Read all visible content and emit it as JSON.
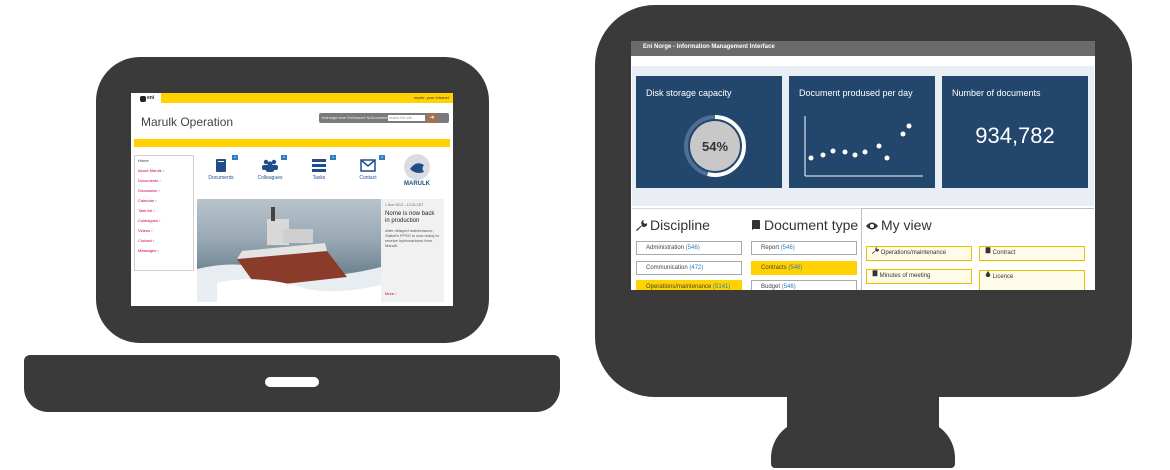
{
  "laptop": {
    "header": {
      "logo_text": "eni",
      "login_text": "mystir: your intranet",
      "title": "Marulk Operation",
      "search_links": "eninorge.com  Enhanced  NoDocument",
      "search_placeholder": "search the site...",
      "search_button": "➔"
    },
    "sidebar": {
      "items": [
        {
          "label": "Home"
        },
        {
          "label": "About Marulk ›"
        },
        {
          "label": "Documents ›"
        },
        {
          "label": "Discussion ›"
        },
        {
          "label": "Calendar ›"
        },
        {
          "label": "Task list ›"
        },
        {
          "label": "Colleagues ›"
        },
        {
          "label": "Videos ›"
        },
        {
          "label": "Contact ›"
        },
        {
          "label": "Messages ›"
        }
      ]
    },
    "tiles": [
      {
        "label": "Documents",
        "badge": "4"
      },
      {
        "label": "Colleagues",
        "badge": "3"
      },
      {
        "label": "Tasks",
        "badge": "4"
      },
      {
        "label": "Contact",
        "badge": "4"
      }
    ],
    "marulk_label": "MARULK",
    "news": {
      "date": "1 Nov 2013 – 12:34 CET",
      "headline": "Norne is now back in production",
      "body": "After delayed maintenance, Statoil's FPSO is now ready to receive hydrocarbons from Marulk.",
      "more": "More ›"
    }
  },
  "monitor": {
    "window_title": "Eni Norge - Information Management Interface",
    "cards": {
      "disk": {
        "caption": "Disk storage capacity",
        "value_label": "54%",
        "percent": 54
      },
      "docs_per_day": {
        "caption": "Document prodused per day"
      },
      "num_docs": {
        "caption": "Number of documents",
        "value": "934,782"
      }
    },
    "discipline": {
      "heading": "Discipline",
      "items": [
        {
          "label": "Administration",
          "count": "(546)",
          "selected": false
        },
        {
          "label": "Communication",
          "count": "(472)",
          "selected": false
        },
        {
          "label": "Operations/maintenance",
          "count": "(5141)",
          "selected": true
        }
      ]
    },
    "document_type": {
      "heading": "Document type",
      "items": [
        {
          "label": "Report",
          "count": "(546)",
          "selected": false
        },
        {
          "label": "Contracts",
          "count": "(546)",
          "selected": true
        },
        {
          "label": "Budget",
          "count": "(546)",
          "selected": false
        }
      ]
    },
    "my_view": {
      "heading": "My view",
      "items": [
        {
          "label": "Operations/maintenance",
          "icon": "wrench-icon"
        },
        {
          "label": "Contract",
          "icon": "book-icon"
        },
        {
          "label": "Minutes of meeting",
          "icon": "book-icon"
        },
        {
          "label": "Licence",
          "icon": "drop-icon"
        }
      ]
    }
  },
  "colors": {
    "device": "#3a3a3a",
    "accent_yellow": "#ffd200",
    "card_blue": "#23466d",
    "link_magenta": "#c0005a"
  }
}
